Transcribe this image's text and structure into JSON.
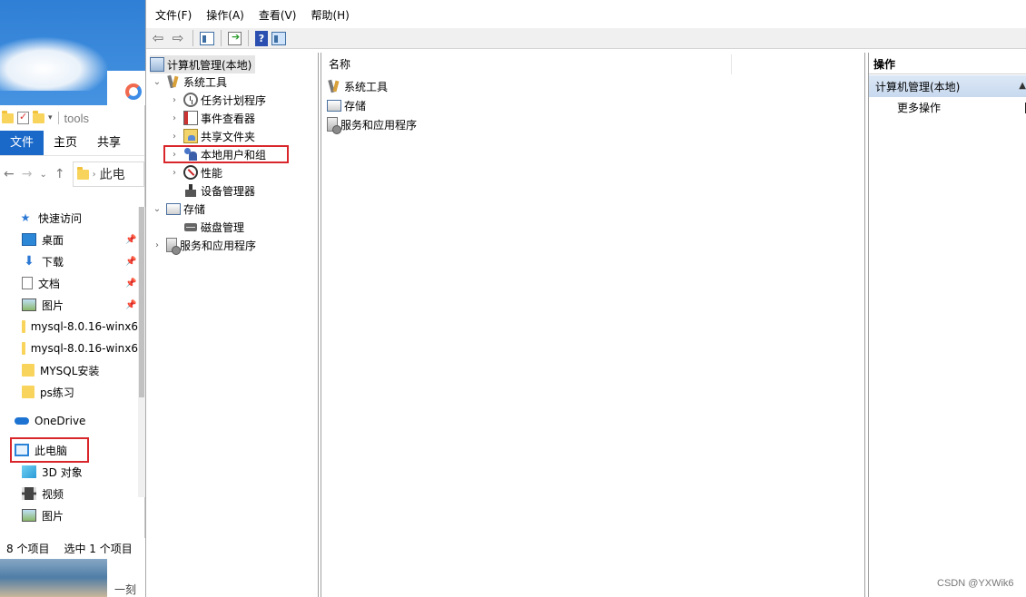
{
  "explorer": {
    "title_path": "tools",
    "ribbon_tabs": [
      "文件",
      "主页",
      "共享"
    ],
    "address_text": "此电",
    "quick_access_label": "快速访问",
    "nav_items": [
      {
        "label": "桌面"
      },
      {
        "label": "下载"
      },
      {
        "label": "文档"
      },
      {
        "label": "图片"
      },
      {
        "label": "mysql-8.0.16-winx6"
      },
      {
        "label": "mysql-8.0.16-winx6"
      },
      {
        "label": "MYSQL安装"
      },
      {
        "label": "ps练习"
      }
    ],
    "onedrive_label": "OneDrive",
    "this_pc_label": "此电脑",
    "pc_items": [
      {
        "label": "3D 对象"
      },
      {
        "label": "视频"
      },
      {
        "label": "图片"
      }
    ],
    "status_count": "8 个项目",
    "status_selected": "选中 1 个项目"
  },
  "desktop_note": "一刻相",
  "mmc": {
    "menu": [
      "文件(F)",
      "操作(A)",
      "查看(V)",
      "帮助(H)"
    ],
    "tree": {
      "root": "计算机管理(本地)",
      "system_tools": "系统工具",
      "task_scheduler": "任务计划程序",
      "event_viewer": "事件查看器",
      "shared_folders": "共享文件夹",
      "local_users_groups": "本地用户和组",
      "performance": "性能",
      "device_manager": "设备管理器",
      "storage": "存储",
      "disk_management": "磁盘管理",
      "services_apps": "服务和应用程序"
    },
    "center": {
      "column_name": "名称",
      "items": [
        "系统工具",
        "存储",
        "服务和应用程序"
      ]
    },
    "actions": {
      "header": "操作",
      "section": "计算机管理(本地)",
      "more_actions": "更多操作"
    }
  },
  "watermark": "CSDN @YXWik6",
  "colors": {
    "highlight_box": "#d9262b",
    "ribbon_active": "#1a69c9",
    "actions_section": "#c8d9ef"
  }
}
